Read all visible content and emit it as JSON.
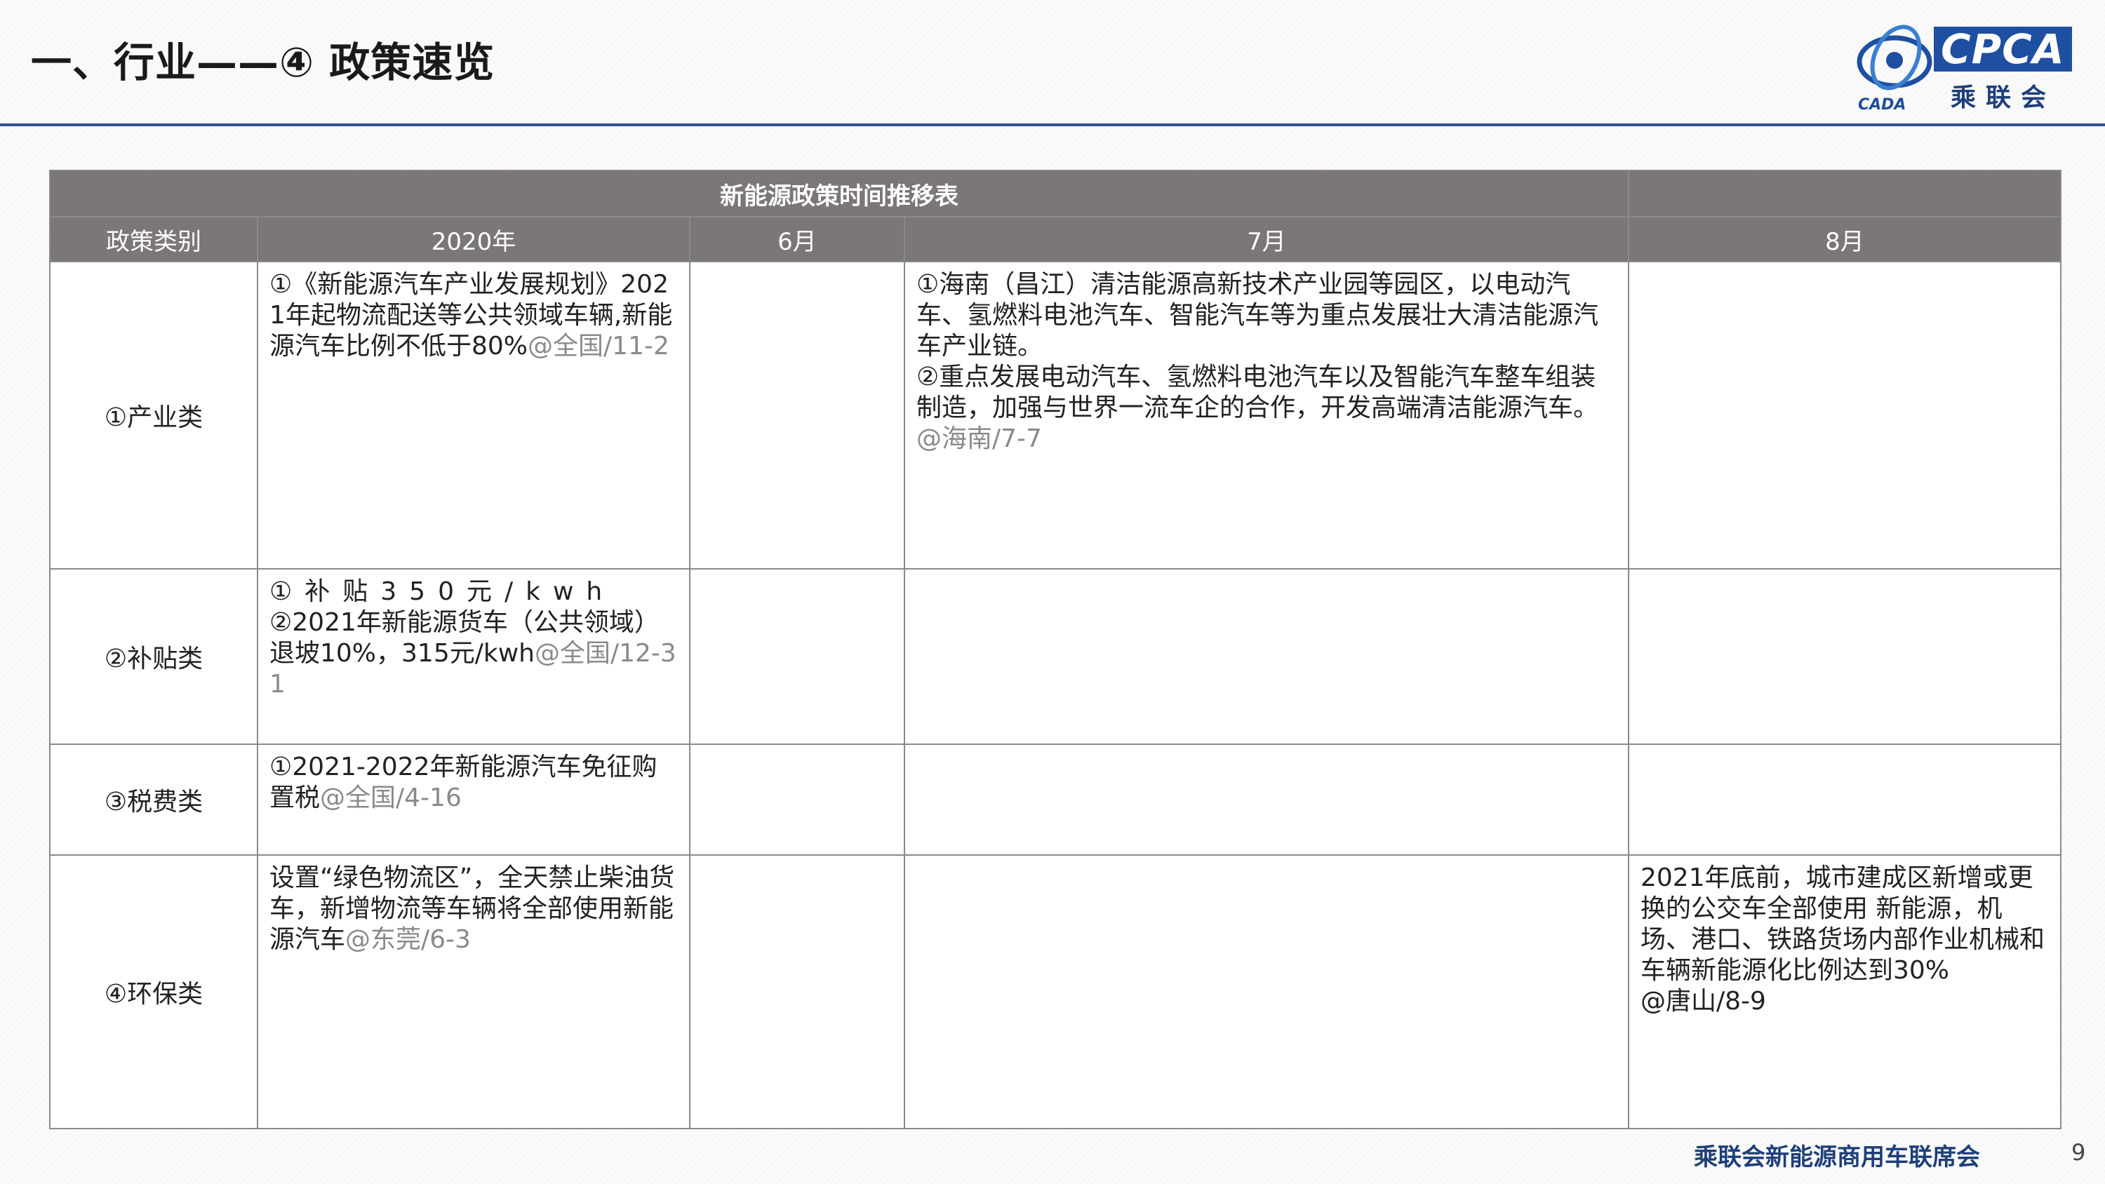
{
  "page": {
    "title": "一、行业——④ 政策速览",
    "page_number": "9",
    "footer_org": "乘联会新能源商用车联席会"
  },
  "logo": {
    "text_en": "CPCA",
    "text_cn": "乘联会",
    "mark_text": "CADA",
    "brand_color": "#1e4fa0"
  },
  "table": {
    "title": "新能源政策时间推移表",
    "headers": [
      "政策类别",
      "2020年",
      "6月",
      "7月",
      "8月"
    ],
    "header_bg": "#7b7677",
    "rows": [
      {
        "category": "①产业类",
        "c2020": {
          "text": "①《新能源汽车产业发展规划》2021年起物流配送等公共领域车辆,新能源汽车比例不低于80%",
          "source": "@全国/11-2"
        },
        "c6": {
          "text": "",
          "source": ""
        },
        "c7": {
          "text": "①海南（昌江）清洁能源高新技术产业园等园区，以电动汽车、氢燃料电池汽车、智能汽车等为重点发展壮大清洁能源汽车产业链。",
          "text2": "②重点发展电动汽车、氢燃料电池汽车以及智能汽车整车组装制造，加强与世界一流车企的合作，开发高端清洁能源汽车。",
          "source": "@海南/7-7"
        },
        "c8": {
          "text": "",
          "source": ""
        }
      },
      {
        "category": "②补贴类",
        "c2020": {
          "text_line1": "①补贴350元/kwh",
          "text": "②2021年新能源货车（公共领域）退坡10%，315元/kwh",
          "source": "@全国/12-31"
        },
        "c6": {
          "text": "",
          "source": ""
        },
        "c7": {
          "text": "",
          "source": ""
        },
        "c8": {
          "text": "",
          "source": ""
        }
      },
      {
        "category": "③税费类",
        "c2020": {
          "text": "①2021-2022年新能源汽车免征购置税",
          "source": "@全国/4-16"
        },
        "c6": {
          "text": "",
          "source": ""
        },
        "c7": {
          "text": "",
          "source": ""
        },
        "c8": {
          "text": "",
          "source": ""
        }
      },
      {
        "category": "④环保类",
        "c2020": {
          "text": "设置“绿色物流区”，全天禁止柴油货车，新增物流等车辆将全部使用新能源汽车",
          "source": "@东莞/6-3"
        },
        "c6": {
          "text": "",
          "source": ""
        },
        "c7": {
          "text": "",
          "source": ""
        },
        "c8": {
          "text": "2021年底前，城市建成区新增或更换的公交车全部使用 新能源，机场、港口、铁路货场内部作业机械和车辆新能源化比例达到30%",
          "source": "@唐山/8-9"
        }
      }
    ]
  }
}
